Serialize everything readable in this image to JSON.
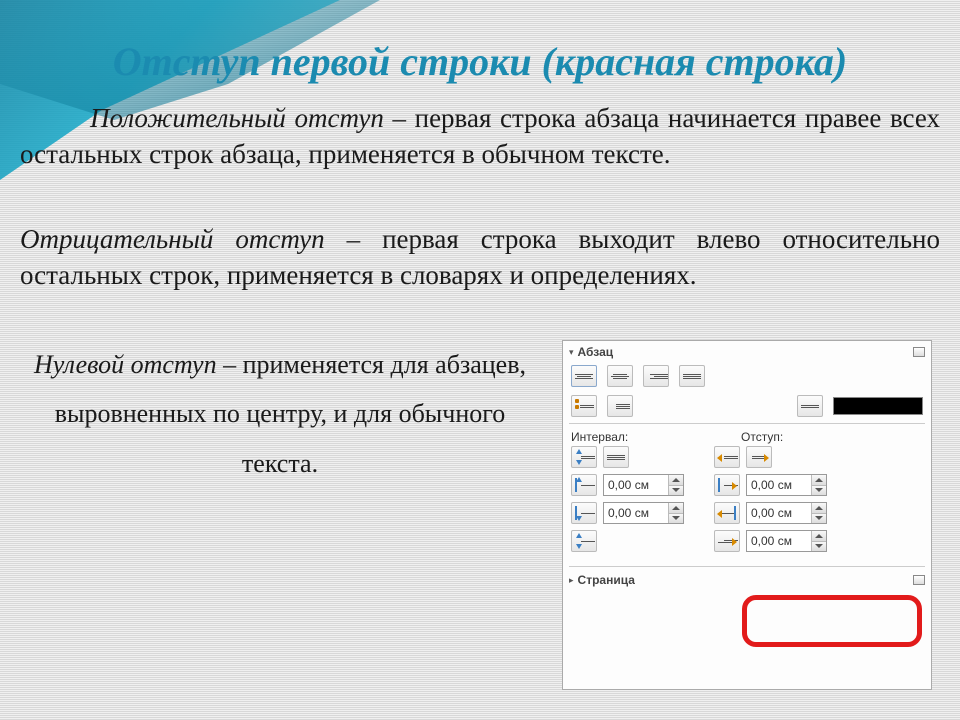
{
  "title": "Отступ первой строки (красная строка)",
  "para1_em": "Положительный отступ",
  "para1_rest": " – первая строка абзаца начинается правее всех остальных строк абзаца, применяется в обычном тексте.",
  "para2_em": "Отрицательный отступ",
  "para2_rest": " – первая строка выходит влево относительно остальных строк, применяется в словарях и определениях.",
  "para3_em": "Нулевой отступ",
  "para3_rest": " – применяется для абзацев, выровненных по центру, и для обычного текста.",
  "panel": {
    "section1": "Абзац",
    "label_interval": "Интервал:",
    "label_indent": "Отступ:",
    "spin_value": "0,00 см",
    "section2": "Страница"
  }
}
